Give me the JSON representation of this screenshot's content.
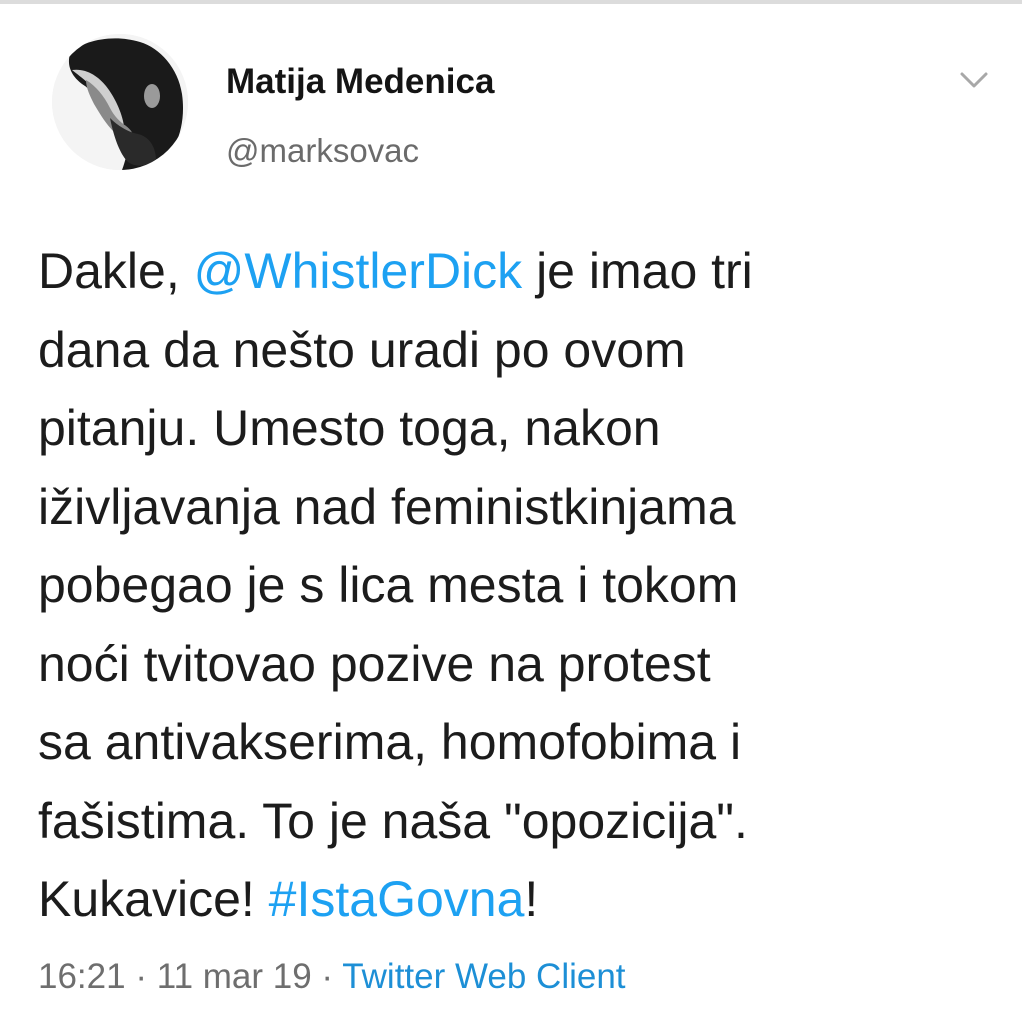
{
  "author": {
    "display_name": "Matija Medenica",
    "handle": "@marksovac"
  },
  "tweet": {
    "lines": [
      [
        {
          "text": "Dakle, "
        },
        {
          "text": "@WhistlerDick",
          "link": true
        },
        {
          "text": " je imao tri"
        }
      ],
      [
        {
          "text": "dana da nešto uradi po ovom"
        }
      ],
      [
        {
          "text": "pitanju. Umesto toga, nakon"
        }
      ],
      [
        {
          "text": "iživljavanja nad feministkinjama"
        }
      ],
      [
        {
          "text": "pobegao je s lica mesta i tokom"
        }
      ],
      [
        {
          "text": "noći tvitovao pozive na protest"
        }
      ],
      [
        {
          "text": "sa antivakserima, homofobima i"
        }
      ],
      [
        {
          "text": "fašistima. To je naša \"opozicija\"."
        }
      ],
      [
        {
          "text": "Kukavice! "
        },
        {
          "text": "#IstaGovna",
          "link": true
        },
        {
          "text": "!"
        }
      ]
    ]
  },
  "meta": {
    "time": "16:21",
    "separator1": " · ",
    "date": "11 mar 19",
    "separator2": " · ",
    "source": "Twitter Web Client"
  },
  "colors": {
    "link": "#1da1f2",
    "text": "#1c1c1c",
    "muted": "#6e6e6e"
  },
  "icons": {
    "menu": "chevron-down-icon",
    "avatar": "profile-photo"
  }
}
